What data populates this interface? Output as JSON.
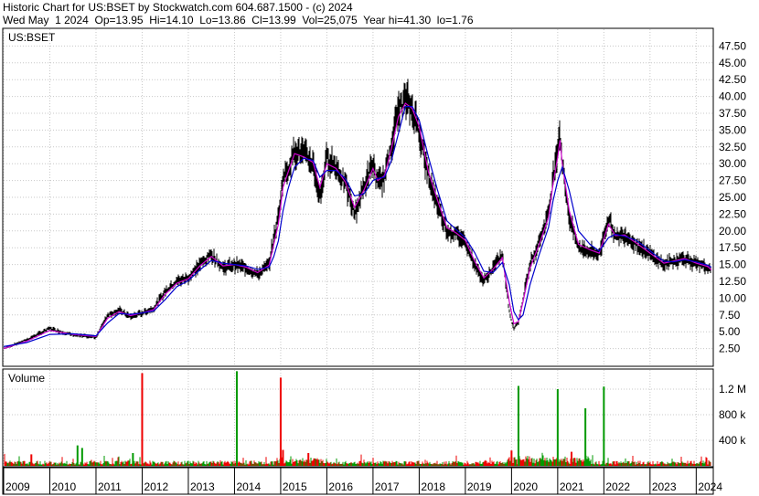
{
  "header": {
    "line1": "Historic Chart for US:BSET by Stockwatch.com 604.687.1500 - (c) 2024",
    "line2": "Wed May  1 2024  Op=13.95  Hi=14.10  Lo=13.86  Cl=13.99  Vol=25,075  Year hi=41.30  lo=1.76"
  },
  "colors": {
    "price_bar": "#000000",
    "ma_short": "#cc00cc",
    "ma_long": "#0000cc",
    "vol_up": "#009900",
    "vol_down": "#ee0000",
    "grid": "#c8c8c8"
  },
  "chart_data": [
    {
      "type": "line",
      "panel": "price",
      "label": "US:BSET",
      "y_ticks": [
        "2.50",
        "5.00",
        "7.50",
        "10.00",
        "12.50",
        "15.00",
        "17.50",
        "20.00",
        "22.50",
        "25.00",
        "27.50",
        "30.00",
        "32.50",
        "35.00",
        "37.50",
        "40.00",
        "42.50",
        "45.00",
        "47.50"
      ],
      "ylim": [
        0,
        50
      ],
      "grid": true,
      "x": [
        2009.0,
        2009.5,
        2010.0,
        2010.5,
        2011.0,
        2011.25,
        2011.5,
        2011.75,
        2012.0,
        2012.25,
        2012.5,
        2012.75,
        2013.0,
        2013.25,
        2013.5,
        2013.75,
        2014.0,
        2014.25,
        2014.5,
        2014.75,
        2014.85,
        2014.95,
        2015.05,
        2015.15,
        2015.3,
        2015.5,
        2015.7,
        2015.85,
        2016.0,
        2016.2,
        2016.4,
        2016.6,
        2016.8,
        2017.0,
        2017.1,
        2017.25,
        2017.4,
        2017.55,
        2017.7,
        2017.85,
        2018.0,
        2018.2,
        2018.4,
        2018.6,
        2018.8,
        2019.0,
        2019.2,
        2019.4,
        2019.6,
        2019.8,
        2019.95,
        2020.05,
        2020.15,
        2020.25,
        2020.4,
        2020.6,
        2020.8,
        2020.9,
        2021.0,
        2021.05,
        2021.1,
        2021.25,
        2021.45,
        2021.7,
        2021.9,
        2022.1,
        2022.25,
        2022.45,
        2022.7,
        2022.9,
        2023.1,
        2023.3,
        2023.5,
        2023.75,
        2024.0,
        2024.25,
        2024.33
      ],
      "series": [
        {
          "name": "Close",
          "values": [
            2.5,
            3.8,
            5.5,
            4.5,
            4.2,
            7.5,
            8.2,
            7.2,
            7.8,
            8.5,
            11,
            12.5,
            13,
            15,
            16.5,
            14.5,
            15,
            14.5,
            13.5,
            15,
            19,
            22,
            28,
            29,
            32,
            31.5,
            30,
            25,
            31,
            29.5,
            27,
            22.5,
            26.5,
            30,
            27,
            28,
            33,
            38,
            39.5,
            38,
            35,
            28,
            24,
            20,
            19.5,
            18.5,
            15,
            12.5,
            14.5,
            16.5,
            8,
            5.5,
            6.5,
            10,
            15,
            18.5,
            22.5,
            28,
            32.5,
            35,
            30,
            22,
            17.5,
            17,
            16.5,
            22,
            19,
            19.5,
            18,
            17,
            16,
            15,
            15.5,
            16,
            15,
            14.5,
            13.99
          ]
        },
        {
          "name": "MA short",
          "values": [
            2.5,
            3.6,
            5.2,
            4.6,
            4.3,
            7,
            8,
            7.4,
            7.8,
            8.3,
            10.6,
            12.2,
            12.9,
            14.8,
            16.2,
            14.8,
            15,
            14.6,
            13.8,
            14.9,
            18,
            21,
            26.5,
            28.5,
            31.5,
            31,
            30.2,
            26.5,
            30,
            29.3,
            27.3,
            23.5,
            26,
            29.3,
            27.5,
            28.2,
            32.3,
            37,
            39,
            38.2,
            35.5,
            28.8,
            24.5,
            20.5,
            19.7,
            18.6,
            15.5,
            13,
            14.3,
            16,
            9.5,
            6.2,
            6.5,
            9.5,
            14.5,
            18,
            22,
            27,
            31,
            33.5,
            30,
            23,
            18,
            17.2,
            16.7,
            21,
            19.3,
            19.4,
            18.2,
            17.2,
            16.2,
            15.2,
            15.5,
            15.9,
            15.2,
            14.7,
            14.2
          ]
        },
        {
          "name": "MA long",
          "values": [
            2.8,
            3.4,
            4.6,
            4.7,
            4.4,
            6.3,
            7.7,
            7.6,
            7.8,
            8.1,
            9.8,
            11.7,
            12.6,
            14.2,
            15.6,
            15.2,
            15,
            14.8,
            14.3,
            14.6,
            16.2,
            18.5,
            23,
            26,
            29.5,
            30.8,
            30.5,
            28,
            29,
            29,
            27.8,
            25.2,
            25.5,
            27.5,
            27.8,
            28,
            30.5,
            34.5,
            38.5,
            38.5,
            36.5,
            31,
            26,
            21.5,
            20.2,
            19,
            16.8,
            14,
            13.8,
            15.3,
            12,
            8,
            6.8,
            7.5,
            12,
            16.5,
            20.5,
            24.5,
            27.5,
            28.5,
            29.5,
            26,
            20,
            18,
            17,
            19,
            19.5,
            19.2,
            18.6,
            17.6,
            16.5,
            15.5,
            15.4,
            15.7,
            15.4,
            14.9,
            14.6
          ]
        }
      ]
    },
    {
      "type": "bar",
      "panel": "volume",
      "label": "Volume",
      "y_ticks": [
        "400 k",
        "800 k",
        "1.2 M"
      ],
      "ylim": [
        0,
        1500000
      ],
      "grid": true,
      "x_tick_labels": [
        "2009",
        "2010",
        "2011",
        "2012",
        "2013",
        "2014",
        "2015",
        "2016",
        "2017",
        "2018",
        "2019",
        "2020",
        "2021",
        "2022",
        "2023",
        "2024"
      ],
      "spikes": [
        {
          "x": 2009.6,
          "value": 180000,
          "direction": "down"
        },
        {
          "x": 2010.6,
          "value": 320000,
          "direction": "up"
        },
        {
          "x": 2010.7,
          "value": 280000,
          "direction": "up"
        },
        {
          "x": 2011.8,
          "value": 200000,
          "direction": "up"
        },
        {
          "x": 2012.0,
          "value": 1450000,
          "direction": "down"
        },
        {
          "x": 2014.05,
          "value": 1480000,
          "direction": "up"
        },
        {
          "x": 2015.0,
          "value": 1380000,
          "direction": "down"
        },
        {
          "x": 2015.05,
          "value": 250000,
          "direction": "down"
        },
        {
          "x": 2015.6,
          "value": 200000,
          "direction": "down"
        },
        {
          "x": 2020.15,
          "value": 1250000,
          "direction": "up"
        },
        {
          "x": 2020.0,
          "value": 240000,
          "direction": "down"
        },
        {
          "x": 2021.0,
          "value": 1200000,
          "direction": "up"
        },
        {
          "x": 2021.6,
          "value": 900000,
          "direction": "up"
        },
        {
          "x": 2022.0,
          "value": 1240000,
          "direction": "up"
        },
        {
          "x": 2021.3,
          "value": 220000,
          "direction": "down"
        }
      ]
    }
  ]
}
